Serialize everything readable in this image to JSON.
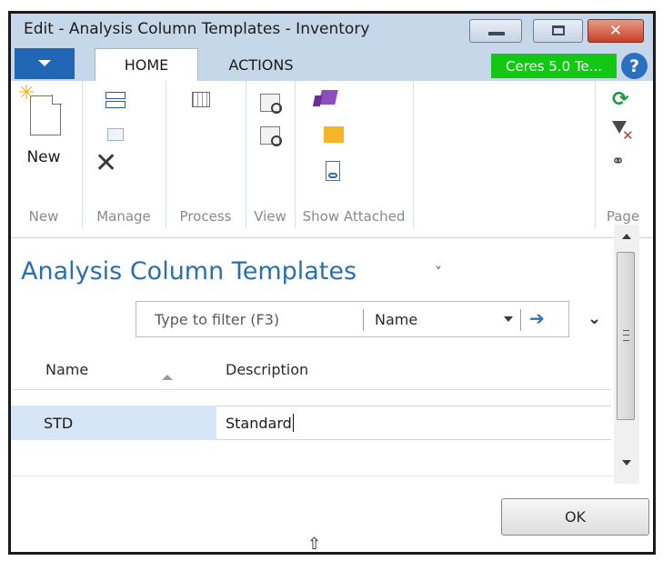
{
  "window": {
    "title": "Edit - Analysis Column Templates - Inventory",
    "close_glyph": "✕"
  },
  "ribbon_tabs": {
    "home": "HOME",
    "actions": "ACTIONS"
  },
  "company": "Ceres 5.0 Te...",
  "help_glyph": "?",
  "ribbon": {
    "new_button": "New",
    "groups": [
      "New",
      "Manage",
      "Process",
      "View",
      "Show Attached",
      "Page"
    ]
  },
  "page": {
    "title": "Analysis Column Templates",
    "title_caret": "˅"
  },
  "filter": {
    "placeholder": "Type to filter (F3)",
    "field": "Name",
    "go_glyph": "➔",
    "expand_glyph": "✔"
  },
  "table": {
    "columns": [
      "Name",
      "Description"
    ],
    "rows": [
      {
        "name": "STD",
        "description": "Standard"
      }
    ]
  },
  "footer": {
    "ok_label": "OK",
    "resize_glyph": "⇧"
  },
  "icons": [
    "new-document-icon",
    "edit-list-icon",
    "edit-icon",
    "delete-icon",
    "process-grid-icon",
    "view-icon",
    "edit-view-icon",
    "onenote-icon",
    "note-icon",
    "link-icon",
    "refresh-icon",
    "clear-filter-icon",
    "find-icon",
    "help-icon",
    "sort-ascending-icon"
  ],
  "colors": {
    "accent": "#2066b5",
    "company_bg": "#15c715",
    "title_blue": "#2a6fb2",
    "selection": "#d6e6f6",
    "titlebar": "#c6d7ea"
  }
}
